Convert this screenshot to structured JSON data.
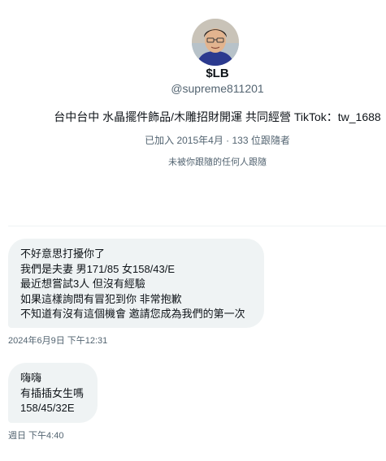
{
  "profile": {
    "display_name": "$LB",
    "handle": "@supreme811201",
    "bio": "台中台中 水晶擺件飾品/木雕招財開運 共同經營 TikTok：tw_1688",
    "joined_followers": "已加入 2015年4月 · 133 位跟隨者",
    "follow_status": "未被你跟隨的任何人跟隨",
    "avatar_icon": "profile-photo"
  },
  "messages": [
    {
      "lines": [
        "不好意思打擾你了",
        "我們是夫妻 男171/85 女158/43/E",
        "最近想嘗試3人 但沒有經驗",
        "如果這樣詢問有冒犯到你 非常抱歉",
        "不知道有沒有這個機會 邀請您成為我們的第一次"
      ],
      "timestamp": "2024年6月9日 下午12:31"
    },
    {
      "lines": [
        "嗨嗨",
        "有插插女生嗎",
        "158/45/32E"
      ],
      "timestamp": "週日 下午4:40"
    }
  ],
  "colors": {
    "bubble": "#eff3f4",
    "secondary_text": "#536471",
    "primary_text": "#0f1419"
  }
}
